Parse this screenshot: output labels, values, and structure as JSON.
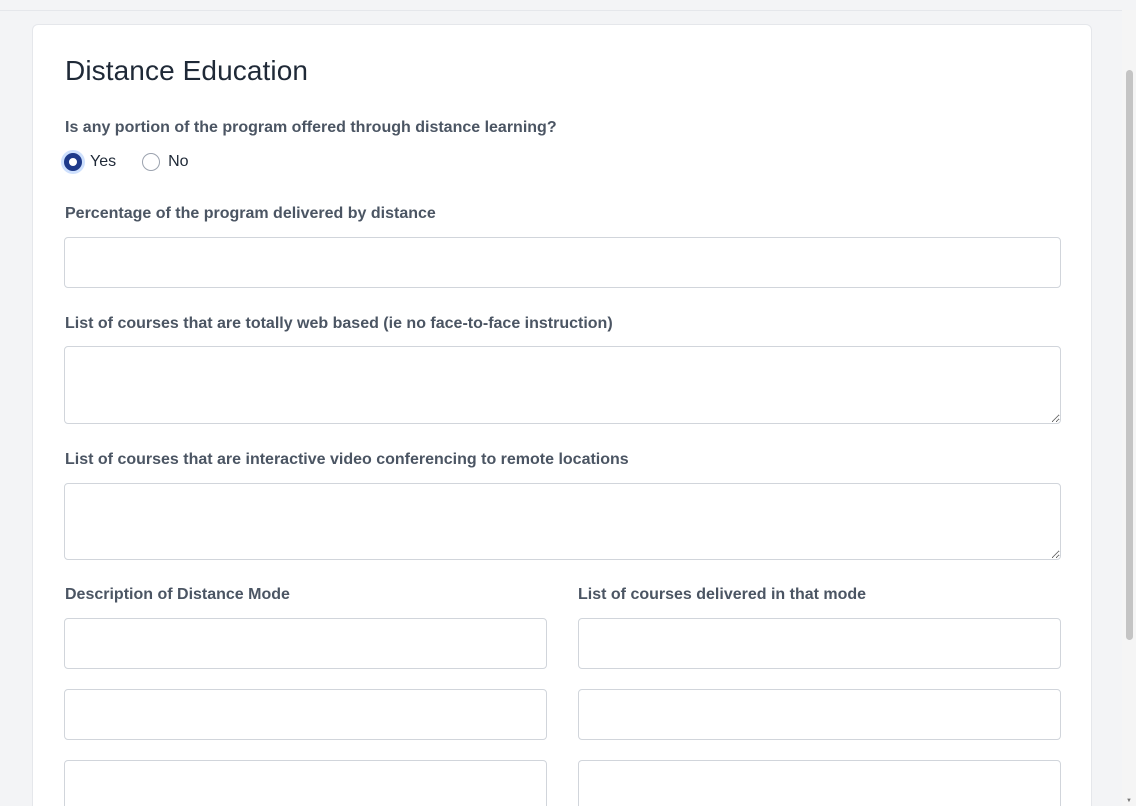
{
  "form": {
    "title": "Distance Education",
    "distance_question": "Is any portion of the program offered through distance learning?",
    "radio_options": [
      {
        "label": "Yes",
        "checked": true
      },
      {
        "label": "No",
        "checked": false
      }
    ],
    "percentage_label": "Percentage of the program delivered by distance",
    "percentage_value": "",
    "web_based_label": "List of courses that are totally web based (ie no face-to-face instruction)",
    "web_based_value": "",
    "video_conf_label": "List of courses that are interactive video conferencing to remote locations",
    "video_conf_value": "",
    "mode_description_label": "Description of Distance Mode",
    "mode_courses_label": "List of courses delivered in that mode",
    "mode_rows": [
      {
        "description": "",
        "courses": ""
      },
      {
        "description": "",
        "courses": ""
      },
      {
        "description": "",
        "courses": ""
      }
    ]
  },
  "colors": {
    "accent": "#1e3a8a",
    "label": "#4b5563",
    "heading": "#1f2937",
    "border": "#d1d5db"
  },
  "icons": {
    "scroll_down": "scroll-down-arrow-icon",
    "resize": "textarea-resize-handle-icon"
  }
}
